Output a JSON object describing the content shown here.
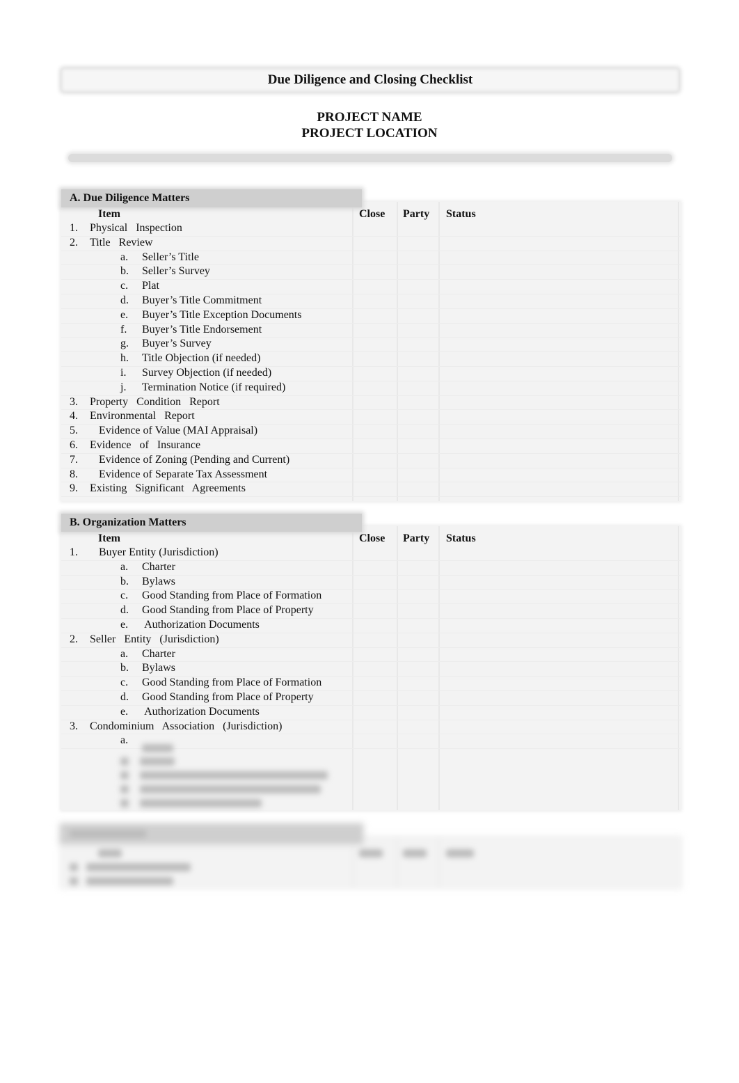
{
  "document": {
    "title": "Due Diligence and Closing Checklist",
    "project_name": "PROJECT NAME",
    "project_location": "PROJECT LOCATION"
  },
  "columns": {
    "item": "Item",
    "close": "Close",
    "party": "Party",
    "status": "Status"
  },
  "section_a": {
    "heading": "A.  Due Diligence Matters",
    "rows": [
      {
        "num": "1.",
        "label": "Physical   Inspection"
      },
      {
        "num": "2.",
        "label": "Title   Review"
      },
      {
        "sub": "a.",
        "label": "Seller’s Title"
      },
      {
        "sub": "b.",
        "label": "Seller’s Survey"
      },
      {
        "sub": "c.",
        "label": "Plat"
      },
      {
        "sub": "d.",
        "label": "Buyer’s Title Commitment"
      },
      {
        "sub": "e.",
        "label": "Buyer’s Title Exception Documents"
      },
      {
        "sub": "f.",
        "label": "Buyer’s Title Endorsement"
      },
      {
        "sub": "g.",
        "label": "Buyer’s Survey"
      },
      {
        "sub": "h.",
        "label": "Title Objection (if needed)"
      },
      {
        "sub": "i.",
        "label": "Survey Objection (if needed)"
      },
      {
        "sub": "j.",
        "label": "Termination Notice (if required)"
      },
      {
        "num": "3.",
        "label": "Property   Condition   Report"
      },
      {
        "num": "4.",
        "label": "Environmental   Report"
      },
      {
        "num": "5.",
        "label": "Evidence of Value (MAI Appraisal)"
      },
      {
        "num": "6.",
        "label": "Evidence   of   Insurance"
      },
      {
        "num": "7.",
        "label": "Evidence of Zoning (Pending and Current)"
      },
      {
        "num": "8.",
        "label": "Evidence of Separate Tax Assessment"
      },
      {
        "num": "9.",
        "label": "Existing   Significant   Agreements"
      }
    ]
  },
  "section_b": {
    "heading": "B.  Organization Matters",
    "rows": [
      {
        "num": "1.",
        "label": "Buyer Entity (Jurisdiction)"
      },
      {
        "sub": "a.",
        "label": "Charter"
      },
      {
        "sub": "b.",
        "label": "Bylaws"
      },
      {
        "sub": "c.",
        "label": "Good Standing from Place of Formation"
      },
      {
        "sub": "d.",
        "label": "Good Standing from Place of Property"
      },
      {
        "sub": "e.",
        "label": " Authorization Documents"
      },
      {
        "num": "2.",
        "label": "Seller   Entity   (Jurisdiction)"
      },
      {
        "sub": "a.",
        "label": "Charter"
      },
      {
        "sub": "b.",
        "label": "Bylaws"
      },
      {
        "sub": "c.",
        "label": "Good Standing from Place of Formation"
      },
      {
        "sub": "d.",
        "label": "Good Standing from Place of Property"
      },
      {
        "sub": "e.",
        "label": " Authorization Documents"
      },
      {
        "num": "3.",
        "label": "Condominium   Association   (Jurisdiction)"
      },
      {
        "sub": "a.",
        "label": ""
      }
    ]
  }
}
